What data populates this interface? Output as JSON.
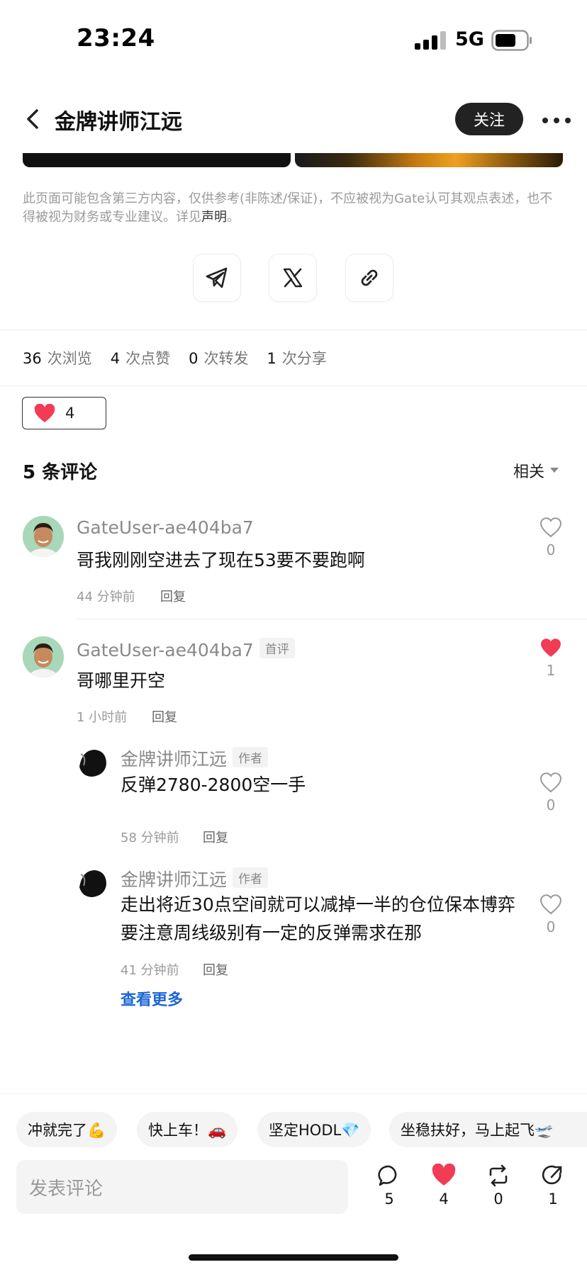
{
  "status_bar": {
    "time": "23:24",
    "network": "5G"
  },
  "header": {
    "title": "金牌讲师江远",
    "follow_label": "关注"
  },
  "disclaimer": {
    "text": "此页面可能包含第三方内容，仅供参考(非陈述/保证)，不应被视为Gate认可其观点表述，也不得被视为财务或专业建议。详见",
    "link": "声明",
    "end": "。"
  },
  "share": {
    "icons": [
      "telegram-icon",
      "x-icon",
      "link-icon"
    ]
  },
  "stats": [
    {
      "value": "36",
      "label": "次浏览"
    },
    {
      "value": "4",
      "label": "次点赞"
    },
    {
      "value": "0",
      "label": "次转发"
    },
    {
      "value": "1",
      "label": "次分享"
    }
  ],
  "reaction": {
    "count": "4"
  },
  "comments_section": {
    "title": "5 条评论",
    "sort_label": "相关"
  },
  "comments": [
    {
      "user": "GateUser-ae404ba7",
      "text": "哥我刚刚空进去了现在53要不要跑啊",
      "time": "44 分钟前",
      "reply": "回复",
      "likes": "0"
    },
    {
      "user": "GateUser-ae404ba7",
      "tag": "首评",
      "text": "哥哪里开空",
      "time": "1 小时前",
      "reply": "回复",
      "likes": "1"
    }
  ],
  "replies": [
    {
      "user": "金牌讲师江远",
      "tag": "作者",
      "text": "反弹2780-2800空一手",
      "time": "58 分钟前",
      "reply": "回复",
      "likes": "0"
    },
    {
      "user": "金牌讲师江远",
      "tag": "作者",
      "text": "走出将近30点空间就可以减掉一半的仓位保本博弈 要注意周线级别有一定的反弹需求在那",
      "time": "41 分钟前",
      "reply": "回复",
      "likes": "0"
    }
  ],
  "view_more": "查看更多",
  "quick_replies": [
    "冲就完了💪",
    "快上车！🚗",
    "坚定HODL💎",
    "坐稳扶好，马上起飞🛫"
  ],
  "bottom": {
    "input_placeholder": "发表评论",
    "comment_count": "5",
    "like_count": "4",
    "repost_count": "0",
    "share_count": "1"
  },
  "colors": {
    "like_red": "#f23b55",
    "link_blue": "#1a66d6",
    "button_dark": "#222222"
  }
}
